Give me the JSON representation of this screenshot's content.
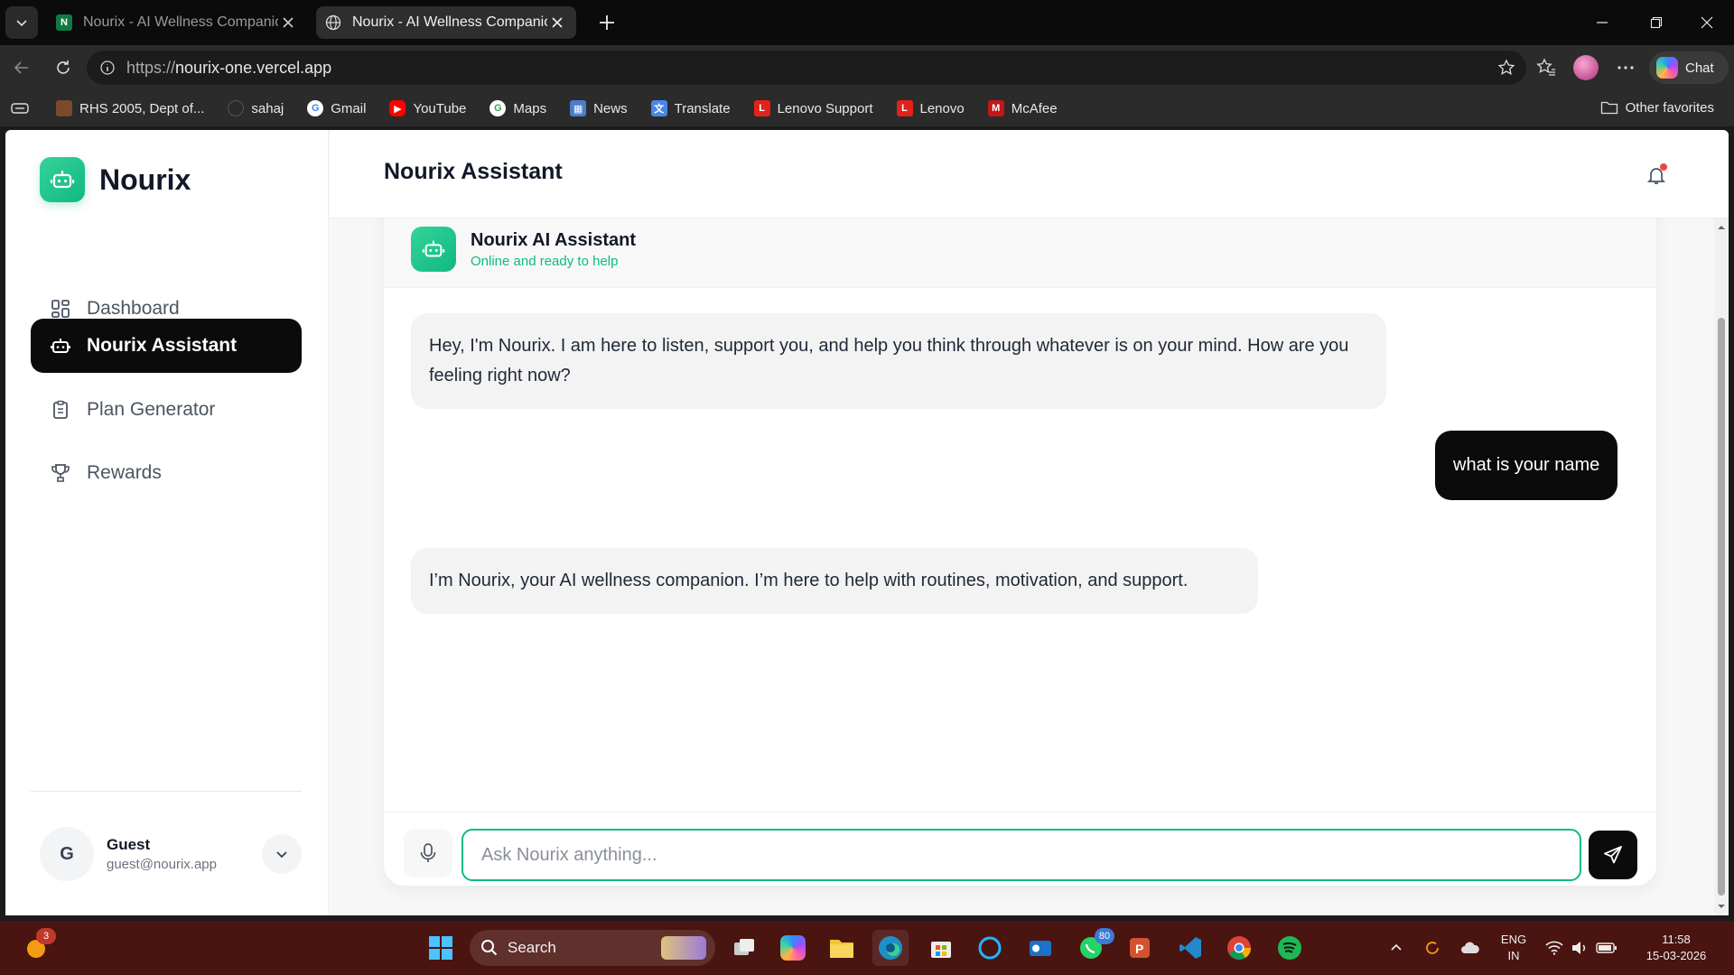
{
  "browser": {
    "tabs": [
      {
        "title": "Nourix - AI Wellness Companion",
        "favicon": "N"
      },
      {
        "title": "Nourix - AI Wellness Companion",
        "favicon": "globe-icon"
      }
    ],
    "url_protocol": "https://",
    "url_host": "nourix-one.vercel.app",
    "chat_label": "Chat",
    "favorites": [
      {
        "label": "RHS 2005, Dept of...",
        "color": "#7a4b2a"
      },
      {
        "label": "sahaj",
        "color": "#2b2b2b"
      },
      {
        "label": "Gmail",
        "color": "#ffffff"
      },
      {
        "label": "YouTube",
        "color": "#ff0000"
      },
      {
        "label": "Maps",
        "color": "#ffffff"
      },
      {
        "label": "News",
        "color": "#4d7cc9"
      },
      {
        "label": "Translate",
        "color": "#4a86e8"
      },
      {
        "label": "Lenovo Support",
        "color": "#e2231a"
      },
      {
        "label": "Lenovo",
        "color": "#e2231a"
      },
      {
        "label": "McAfee",
        "color": "#c01818"
      }
    ],
    "other_favorites": "Other favorites"
  },
  "app": {
    "brand": "Nourix",
    "accent": "#10b981",
    "nav": [
      {
        "label": "Dashboard",
        "icon": "dashboard-icon",
        "active": false
      },
      {
        "label": "Nourix Assistant",
        "icon": "bot-icon",
        "active": true
      },
      {
        "label": "Plan Generator",
        "icon": "clipboard-icon",
        "active": false
      },
      {
        "label": "Rewards",
        "icon": "trophy-icon",
        "active": false
      }
    ],
    "user": {
      "initial": "G",
      "name": "Guest",
      "email": "guest@nourix.app"
    },
    "header_title": "Nourix Assistant",
    "assistant": {
      "name": "Nourix AI Assistant",
      "status": "Online and ready to help"
    },
    "messages": [
      {
        "role": "bot",
        "text": "Hey, I'm Nourix. I am here to listen, support you, and help you think through whatever is on your mind. How are you feeling right now?"
      },
      {
        "role": "user",
        "text": "what is your name"
      },
      {
        "role": "bot",
        "text": "I’m Nourix, your AI wellness companion. I’m here to help with routines, motivation, and support."
      }
    ],
    "input_placeholder": "Ask Nourix anything..."
  },
  "taskbar": {
    "search_label": "Search",
    "notification_count": "3",
    "whatsapp_badge": "80",
    "lang_line1": "ENG",
    "lang_line2": "IN",
    "time": "11:58",
    "date": "15-03-2026"
  }
}
